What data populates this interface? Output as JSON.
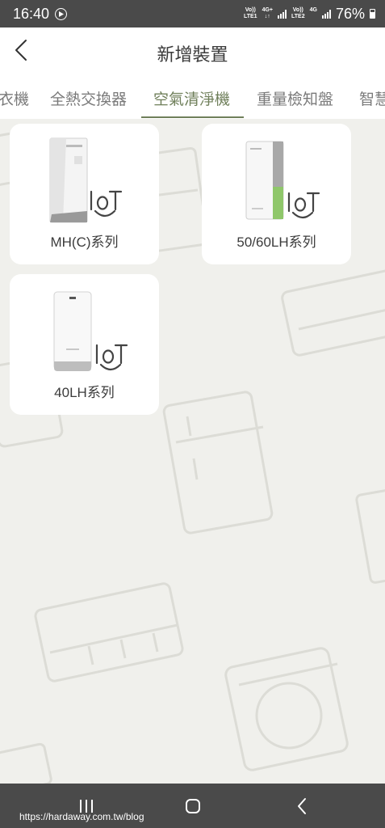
{
  "status_bar": {
    "time": "16:40",
    "sim1_top": "Vo))",
    "sim1_bottom": "LTE1",
    "sim1_type": "4G+",
    "sim2_top": "Vo))",
    "sim2_bottom": "LTE2",
    "sim2_type": "4G",
    "battery": "76%"
  },
  "header": {
    "title": "新增裝置",
    "back_icon": "chevron-left-icon"
  },
  "tabs": [
    {
      "label": "衣機",
      "active": false
    },
    {
      "label": "全熱交換器",
      "active": false
    },
    {
      "label": "空氣清淨機",
      "active": true
    },
    {
      "label": "重量檢知盤",
      "active": false
    },
    {
      "label": "智慧",
      "active": false
    }
  ],
  "devices": [
    {
      "label": "MH(C)系列",
      "badge": "IoT",
      "icon": "air-purifier-large-icon"
    },
    {
      "label": "50/60LH系列",
      "badge": "IoT",
      "icon": "air-purifier-slim-icon"
    },
    {
      "label": "40LH系列",
      "badge": "IoT",
      "icon": "air-purifier-compact-icon"
    }
  ],
  "watermark": "https://hardaway.com.tw/blog",
  "colors": {
    "accent": "#6f7f5a",
    "background": "#f0f0ec",
    "system_bar": "#4a4a4a",
    "card": "#ffffff",
    "device_green": "#8fc76a"
  }
}
